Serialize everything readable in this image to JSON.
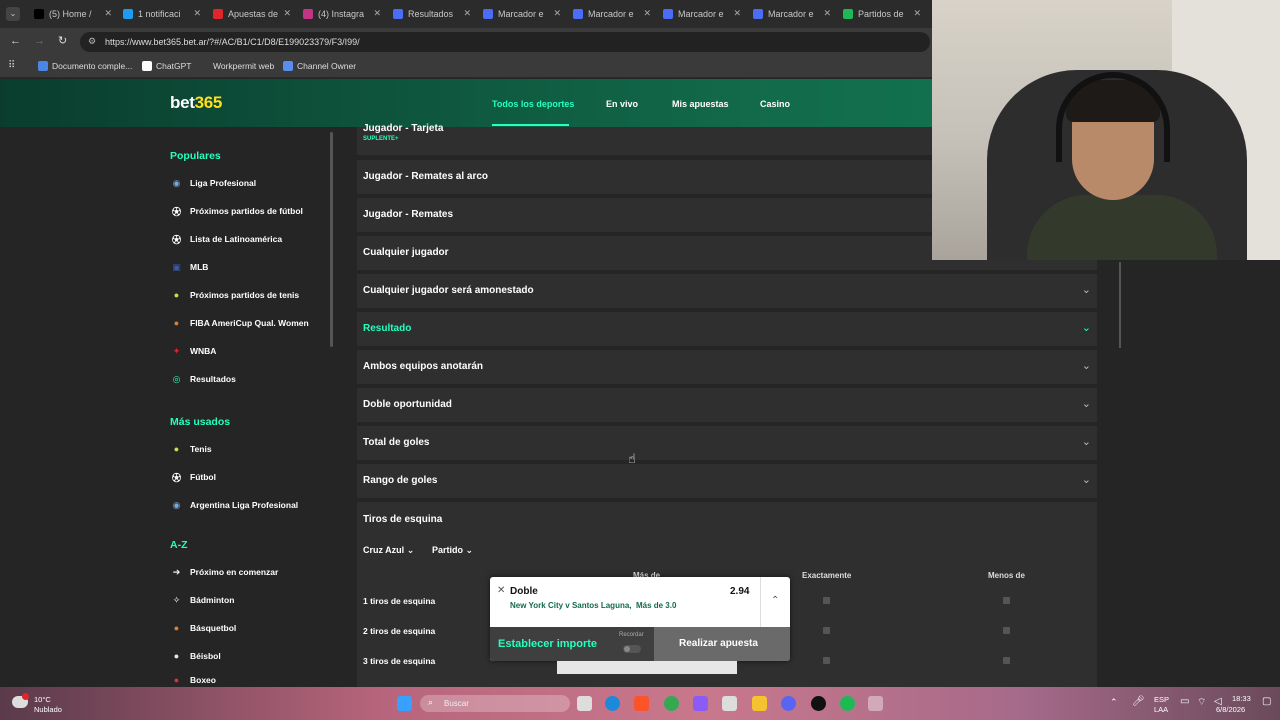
{
  "browser": {
    "tabs": [
      {
        "label": "(5) Home /",
        "color": "#000000"
      },
      {
        "label": "1 notificaci",
        "color": "#1d9bf0"
      },
      {
        "label": "Apuestas de",
        "color": "#e0262b"
      },
      {
        "label": "(4) Instagra",
        "color": "#c13584"
      },
      {
        "label": "Resultados",
        "color": "#4a6cf7"
      },
      {
        "label": "Marcador e",
        "color": "#4a6cf7"
      },
      {
        "label": "Marcador e",
        "color": "#4a6cf7"
      },
      {
        "label": "Marcador e",
        "color": "#4a6cf7"
      },
      {
        "label": "Marcador e",
        "color": "#4a6cf7"
      },
      {
        "label": "Partidos de",
        "color": "#1db954"
      }
    ],
    "url": "https://www.bet365.bet.ar/?#/AC/B1/C1/D8/E199023379/F3/I99/",
    "bookmarks": [
      {
        "label": "Documento comple...",
        "color": "#4a86e8"
      },
      {
        "label": "ChatGPT",
        "color": "#ffffff"
      },
      {
        "label": "Workpermit web",
        "color": "#3a3a3a"
      },
      {
        "label": "Channel Owner",
        "color": "#5b8def"
      }
    ]
  },
  "header": {
    "logo_main": "bet",
    "logo_num": "365",
    "nav": [
      "Todos los deportes",
      "En vivo",
      "Mis apuestas",
      "Casino"
    ]
  },
  "sidebar": {
    "popular_title": "Populares",
    "popular": [
      {
        "label": "Liga Profesional",
        "icon": "argentina-flag-icon"
      },
      {
        "label": "Próximos partidos de fútbol",
        "icon": "soccer-ball-icon"
      },
      {
        "label": "Lista de Latinoamérica",
        "icon": "soccer-ball-icon"
      },
      {
        "label": "MLB",
        "icon": "mlb-logo-icon"
      },
      {
        "label": "Próximos partidos de tenis",
        "icon": "tennis-ball-icon"
      },
      {
        "label": "FIBA AmeriCup Qual. Women",
        "icon": "basketball-icon"
      },
      {
        "label": "WNBA",
        "icon": "wnba-logo-icon"
      },
      {
        "label": "Resultados",
        "icon": "results-icon"
      }
    ],
    "used_title": "Más usados",
    "used": [
      {
        "label": "Tenis",
        "icon": "tennis-ball-icon"
      },
      {
        "label": "Fútbol",
        "icon": "soccer-ball-icon"
      },
      {
        "label": "Argentina Liga Profesional",
        "icon": "argentina-flag-icon"
      }
    ],
    "az_title": "A-Z",
    "az": [
      {
        "label": "Próximo en comenzar",
        "icon": "arrow-right-icon"
      },
      {
        "label": "Bádminton",
        "icon": "shuttlecock-icon"
      },
      {
        "label": "Básquetbol",
        "icon": "basketball-icon"
      },
      {
        "label": "Béisbol",
        "icon": "baseball-icon"
      },
      {
        "label": "Boxeo",
        "icon": "boxing-glove-icon"
      }
    ]
  },
  "markets": {
    "partial_title": "Jugador - Tarjeta",
    "partial_badge": "SUPLENTE+",
    "rows": [
      {
        "label": "Jugador - Remates al arco",
        "expanded": false
      },
      {
        "label": "Jugador - Remates",
        "expanded": false
      },
      {
        "label": "Cualquier jugador",
        "expanded": false
      },
      {
        "label": "Cualquier jugador será amonestado",
        "expanded": false
      },
      {
        "label": "Resultado",
        "expanded": false,
        "highlight": true
      },
      {
        "label": "Ambos equipos anotarán",
        "expanded": false
      },
      {
        "label": "Doble oportunidad",
        "expanded": false
      },
      {
        "label": "Total de goles",
        "expanded": false
      },
      {
        "label": "Rango de goles",
        "expanded": false
      }
    ],
    "corners": {
      "title": "Tiros de esquina",
      "filter_team": "Cruz Azul",
      "filter_period": "Partido",
      "col_over": "Más de",
      "col_exact": "Exactamente",
      "col_under": "Menos de",
      "rows": [
        "1 tiros de esquina",
        "2 tiros de esquina",
        "3 tiros de esquina"
      ]
    }
  },
  "betslip": {
    "title": "Doble",
    "odds": "2.94",
    "selection": "New York City v Santos Laguna,  Más de 3.0",
    "stake_label": "Establecer importe",
    "remember_label": "Recordar",
    "place_label": "Realizar apuesta"
  },
  "taskbar": {
    "weather_temp": "10°C",
    "weather_desc": "Nublado",
    "search_placeholder": "Buscar",
    "lang_top": "ESP",
    "lang_bottom": "LAA",
    "time": "18:33",
    "date": "6/8/2026"
  },
  "colors": {
    "accent": "#26ffbe",
    "header_bg": "#126b4b",
    "panel_bg": "#2f2f2f",
    "page_bg": "#252525"
  }
}
